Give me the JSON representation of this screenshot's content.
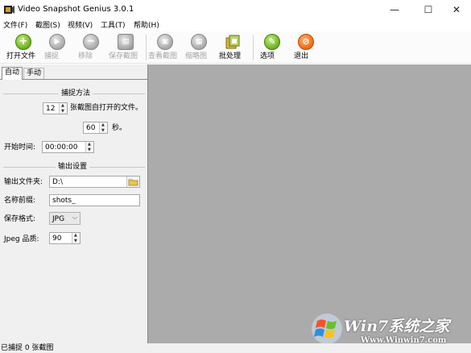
{
  "window": {
    "title": "Video Snapshot Genius 3.0.1",
    "minimize_glyph": "—",
    "maximize_glyph": "☐",
    "close_glyph": "✕"
  },
  "menu": [
    "文件(F)",
    "截图(S)",
    "视频(V)",
    "工具(T)",
    "帮助(H)"
  ],
  "toolbar": {
    "open_file": "打开文件",
    "capture": "捕捉",
    "remove": "移除",
    "save_snapshot": "保存截图",
    "view_snapshot": "查看截图",
    "thumbnail": "缩略图",
    "batch": "批处理",
    "options": "选项",
    "exit": "退出"
  },
  "tabs": {
    "auto": "自动",
    "manual": "手动"
  },
  "capture_method": {
    "heading": "捕捉方法",
    "count": "12",
    "count_label": "张截图自打开的文件。",
    "interval": "60",
    "interval_unit": "秒。",
    "start_time_label": "开始时间:",
    "start_time": "00:00:00"
  },
  "output": {
    "heading": "输出设置",
    "folder_label": "输出文件夹:",
    "folder": "D:\\",
    "prefix_label": "名称前缀:",
    "prefix": "shots_",
    "format_label": "保存格式:",
    "format": "JPG",
    "quality_label": "Jpeg 品质:",
    "quality": "90"
  },
  "status": "已捕捉 0 张截图",
  "watermark": {
    "text_main": "Win7系统之家",
    "text_url": "Www.Winwin7.com"
  },
  "colors": {
    "preview_bg": "#ababab",
    "panel_bg": "#f0f0f0",
    "green_icon": "#6ab024",
    "orange_icon": "#f26a12"
  }
}
